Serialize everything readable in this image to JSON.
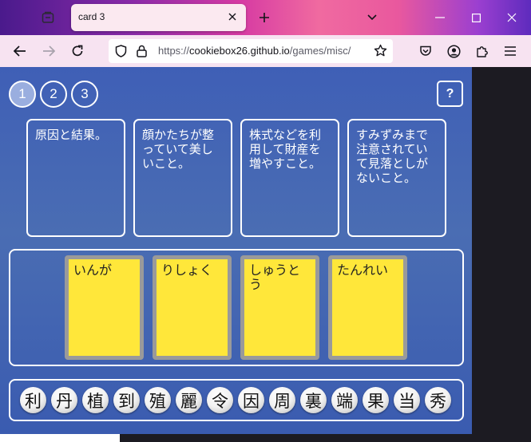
{
  "browser": {
    "tab_title": "card 3",
    "url_scheme": "https://",
    "url_host": "cookiebox26.github.io",
    "url_path": "/games/misc/"
  },
  "game": {
    "stages": [
      "1",
      "2",
      "3"
    ],
    "active_stage": "1",
    "help_label": "?",
    "meanings": [
      "原因と結果。",
      "顔かたちが整っていて美しいこと。",
      "株式などを利用して財産を増やすこと。",
      "すみずみまで注意されていて見落としがないこと。"
    ],
    "readings": [
      "いんが",
      "りしょく",
      "しゅうとう",
      "たんれい"
    ],
    "tiles": [
      "利",
      "丹",
      "植",
      "到",
      "殖",
      "麗",
      "令",
      "因",
      "周",
      "裏",
      "端",
      "果",
      "当",
      "秀"
    ]
  },
  "colors": {
    "accent_blue": "#3f5fb6",
    "card_yellow": "#ffe73a",
    "active_stage": "#9aaedf"
  }
}
